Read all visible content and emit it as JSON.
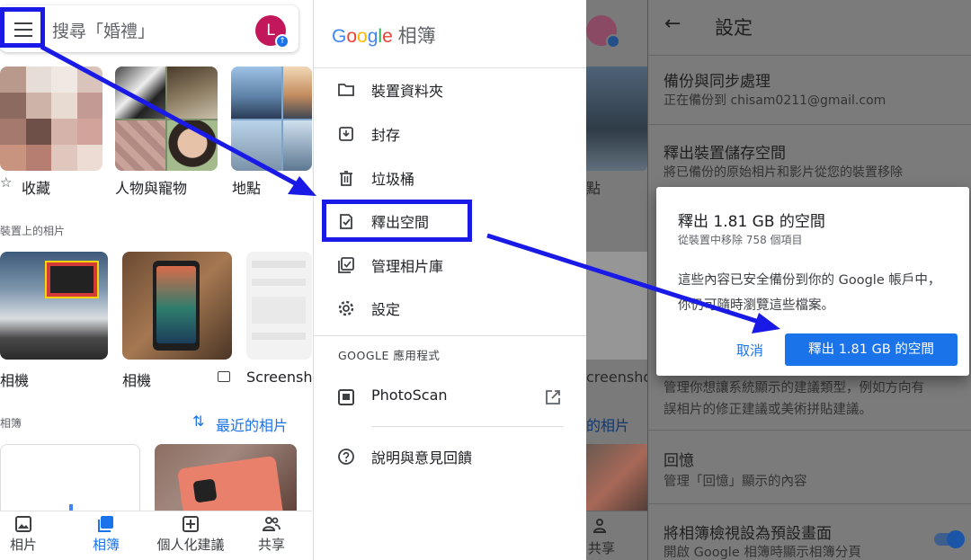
{
  "panel_photos": {
    "search": {
      "placeholder": "搜尋「婚禮」"
    },
    "avatar_initial": "L",
    "groups": [
      {
        "label": "收藏"
      },
      {
        "label": "人物與寵物"
      },
      {
        "label": "地點"
      }
    ],
    "device_section": "裝置上的相片",
    "device_folders": [
      {
        "label": "相機"
      },
      {
        "label": "相機"
      },
      {
        "label": "Screensho"
      }
    ],
    "albums_section": "相簿",
    "recent_albums": "最近的相片",
    "bottom_nav": [
      {
        "label": "相片",
        "icon": "photo-icon"
      },
      {
        "label": "相簿",
        "icon": "albums-icon",
        "active": true
      },
      {
        "label": "個人化建議",
        "icon": "add-box-icon"
      },
      {
        "label": "共享",
        "icon": "people-icon"
      }
    ]
  },
  "drawer": {
    "brand": "Google",
    "title": "相簿",
    "items": [
      {
        "label": "裝置資料夾",
        "icon": "folder-icon"
      },
      {
        "label": "封存",
        "icon": "archive-icon"
      },
      {
        "label": "垃圾桶",
        "icon": "trash-icon"
      },
      {
        "label": "釋出空間",
        "icon": "free-up-icon"
      },
      {
        "label": "管理相片庫",
        "icon": "manage-library-icon"
      },
      {
        "label": "設定",
        "icon": "gear-icon"
      }
    ],
    "apps_header": "GOOGLE 應用程式",
    "photoscan": "PhotoScan",
    "help": "說明與意見回饋"
  },
  "strip": {
    "text1": "點",
    "text2": "creensho",
    "text3": "的相片",
    "nav": "共享"
  },
  "settings": {
    "title": "設定",
    "backup_title": "備份與同步處理",
    "backup_sub": "正在備份到 chisam0211@gmail.com",
    "free_title": "釋出裝置儲存空間",
    "free_sub": "將已備份的原始相片和影片從您的裝置移除",
    "suggest_sub1": "管理你想讓系統顯示的建議類型，例如方向有",
    "suggest_sub2": "誤相片的修正建議或美術拼貼建議。",
    "memories_title": "回憶",
    "memories_sub": "管理「回憶」顯示的內容",
    "default_title": "將相簿檢視設為預設畫面",
    "default_sub": "開啟 Google 相簿時顯示相簿分頁",
    "default_toggle_on": true
  },
  "dialog": {
    "title": "釋出 1.81 GB 的空間",
    "subtitle": "從裝置中移除 758 個項目",
    "body": "這些內容已安全備份到你的 Google 帳戶中，你仍可隨時瀏覽這些檔案。",
    "cancel": "取消",
    "confirm": "釋出 1.81 GB 的空間"
  },
  "colors": {
    "accent": "#1a73e8",
    "annotation": "#1a1ae6",
    "avatar": "#c2185b"
  }
}
